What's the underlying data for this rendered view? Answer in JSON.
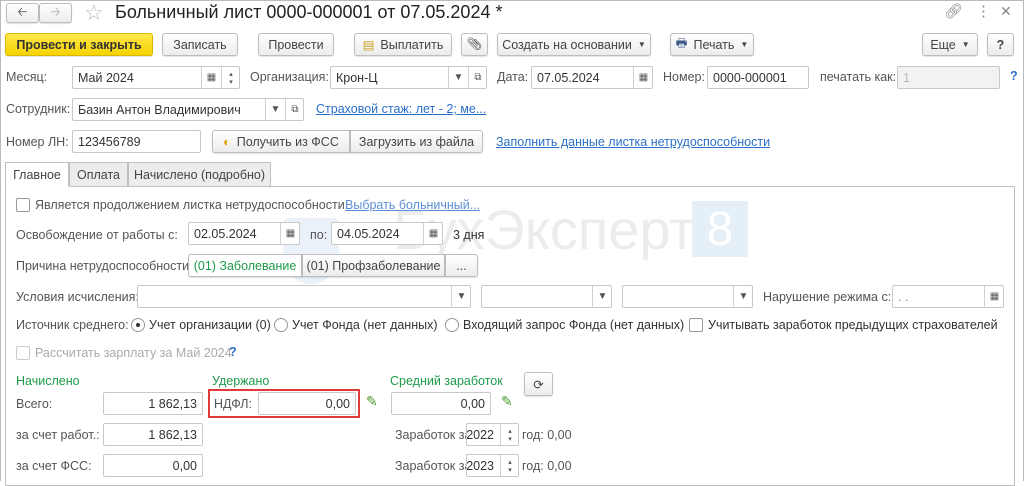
{
  "window": {
    "title": "Больничный лист 0000-000001 от 07.05.2024 *"
  },
  "toolbar": {
    "post_close": "Провести и закрыть",
    "save": "Записать",
    "post": "Провести",
    "pay": "Выплатить",
    "create_based": "Создать на основании",
    "print": "Печать",
    "more": "Еще",
    "help": "?"
  },
  "header": {
    "month_label": "Месяц:",
    "month": "Май 2024",
    "org_label": "Организация:",
    "org": "Крон-Ц",
    "date_label": "Дата:",
    "date": "07.05.2024",
    "number_label": "Номер:",
    "number": "0000-000001",
    "print_as_label": "печатать как:",
    "print_as": "1",
    "help": "?",
    "employee_label": "Сотрудник:",
    "employee": "Базин Антон Владимирович",
    "insurance_link": "Страховой стаж: лет - 2; ме...",
    "ln_label": "Номер ЛН:",
    "ln": "123456789",
    "get_fss": "Получить из ФСС",
    "load_file": "Загрузить из файла",
    "fill_link": "Заполнить данные листка нетрудоспособности"
  },
  "tabs": [
    "Главное",
    "Оплата",
    "Начислено (подробно)"
  ],
  "main": {
    "continuation_label": "Является продолжением листка нетрудоспособности:",
    "choose_link": "Выбрать больничный...",
    "release_label": "Освобождение от работы с:",
    "date_from": "02.05.2024",
    "to_label": "по:",
    "date_to": "04.05.2024",
    "days": "3 дня",
    "reason_label": "Причина нетрудоспособности:",
    "reason_1": "(01) Заболевание",
    "reason_2": "(01) Профзаболевание",
    "reason_more": "...",
    "conditions_label": "Условия исчисления:",
    "violation_label": "Нарушение режима с:",
    "violation_date": " .  .",
    "source_label": "Источник среднего:",
    "source_1": "Учет организации (0)",
    "source_2": "Учет Фонда (нет данных)",
    "source_3": "Входящий запрос Фонда (нет данных)",
    "prev_insurers": "Учитывать заработок предыдущих страхователей",
    "calc_salary": "Рассчитать зарплату за Май 2024",
    "calc_help": "?",
    "accrued_title": "Начислено",
    "withheld_title": "Удержано",
    "avg_title": "Средний заработок",
    "total_label": "Всего:",
    "total": "1 862,13",
    "employer_label": "за счет работ.:",
    "employer": "1 862,13",
    "fss_label": "за счет ФСС:",
    "fss": "0,00",
    "ndfl_label": "НДФЛ:",
    "ndfl": "0,00",
    "avg": "0,00",
    "earn_label": "Заработок за",
    "year1": "2022",
    "year1_val": "год: 0,00",
    "year2": "2023",
    "year2_val": "год: 0,00"
  },
  "watermark": {
    "text": "БухЭксперт",
    "num": "8"
  }
}
